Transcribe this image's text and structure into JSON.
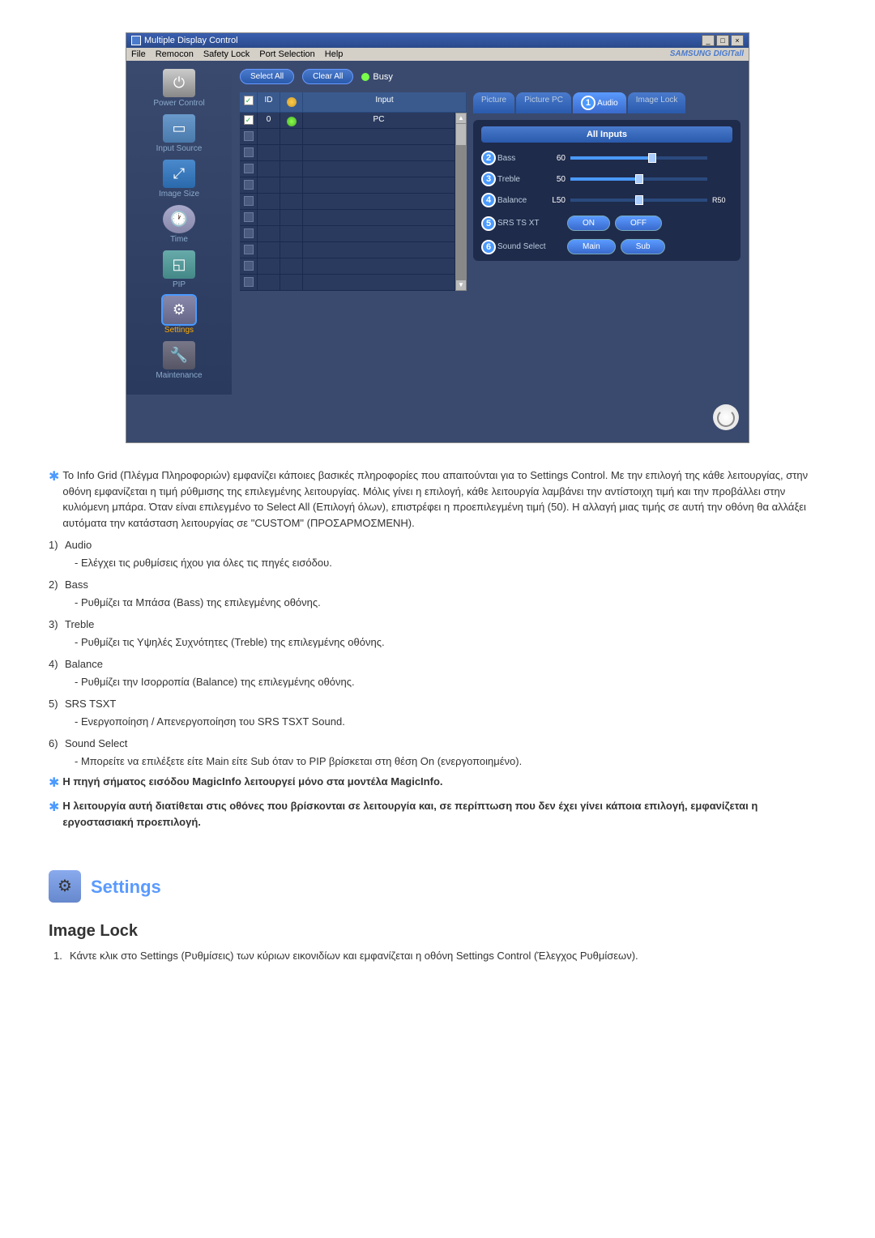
{
  "window": {
    "title": "Multiple Display Control",
    "menu": [
      "File",
      "Remocon",
      "Safety Lock",
      "Port Selection",
      "Help"
    ],
    "brand": "SAMSUNG DIGITall"
  },
  "sidebar": {
    "items": [
      {
        "label": "Power Control"
      },
      {
        "label": "Input Source"
      },
      {
        "label": "Image Size"
      },
      {
        "label": "Time"
      },
      {
        "label": "PIP"
      },
      {
        "label": "Settings"
      },
      {
        "label": "Maintenance"
      }
    ]
  },
  "toolbar": {
    "select_all": "Select All",
    "clear_all": "Clear All",
    "busy": "Busy"
  },
  "grid": {
    "headers": [
      "",
      "ID",
      "",
      "Input"
    ],
    "rows": [
      {
        "checked": true,
        "id": "0",
        "led": "green",
        "input": "PC"
      },
      {
        "checked": false,
        "id": "",
        "led": "",
        "input": ""
      },
      {
        "checked": false
      },
      {
        "checked": false
      },
      {
        "checked": false
      },
      {
        "checked": false
      },
      {
        "checked": false
      },
      {
        "checked": false
      },
      {
        "checked": false
      },
      {
        "checked": false
      },
      {
        "checked": false
      }
    ]
  },
  "tabs": {
    "picture": "Picture",
    "picture_pc": "Picture PC",
    "audio": "Audio",
    "audio_badge": "1",
    "image_lock": "Image Lock"
  },
  "panel": {
    "title": "All Inputs",
    "bass": {
      "badge": "2",
      "label": "Bass",
      "value": "60",
      "pct": 60
    },
    "treble": {
      "badge": "3",
      "label": "Treble",
      "value": "50",
      "pct": 50
    },
    "balance": {
      "badge": "4",
      "label": "Balance",
      "value": "L50",
      "right": "R50",
      "pct": 50
    },
    "srs": {
      "badge": "5",
      "label": "SRS TS XT",
      "on": "ON",
      "off": "OFF"
    },
    "sound_select": {
      "badge": "6",
      "label": "Sound Select",
      "main": "Main",
      "sub": "Sub"
    }
  },
  "doc": {
    "intro": "Το Info Grid (Πλέγμα Πληροφοριών) εμφανίζει κάποιες βασικές πληροφορίες που απαιτούνται για το Settings Control. Με την επιλογή της κάθε λειτουργίας, στην οθόνη εμφανίζεται η τιμή ρύθμισης της επιλεγμένης λειτουργίας. Μόλις γίνει η επιλογή, κάθε λειτουργία λαμβάνει την αντίστοιχη τιμή και την προβάλλει στην κυλιόμενη μπάρα. Όταν είναι επιλεγμένο το Select All (Επιλογή όλων), επιστρέφει η προεπιλεγμένη τιμή (50). Η αλλαγή μιας τιμής σε αυτή την οθόνη θα αλλάξει αυτόματα την κατάσταση λειτουργίας σε \"CUSTOM\" (ΠΡΟΣΑΡΜΟΣΜΕΝΗ).",
    "items": [
      {
        "n": "1)",
        "title": "Audio",
        "desc": "- Ελέγχει τις ρυθμίσεις ήχου για όλες τις πηγές εισόδου."
      },
      {
        "n": "2)",
        "title": "Bass",
        "desc": "- Ρυθμίζει τα Μπάσα (Bass) της επιλεγμένης οθόνης."
      },
      {
        "n": "3)",
        "title": "Treble",
        "desc": "- Ρυθμίζει τις Υψηλές Συχνότητες (Treble) της επιλεγμένης οθόνης."
      },
      {
        "n": "4)",
        "title": "Balance",
        "desc": "- Ρυθμίζει την Ισορροπία (Balance) της επιλεγμένης οθόνης."
      },
      {
        "n": "5)",
        "title": "SRS TSXT",
        "desc": "- Ενεργοποίηση / Απενεργοποίηση του SRS TSXT Sound."
      },
      {
        "n": "6)",
        "title": "Sound Select",
        "desc": "- Μπορείτε να επιλέξετε είτε Main είτε Sub όταν το PIP βρίσκεται στη θέση On (ενεργοποιημένο)."
      }
    ],
    "note1": "Η πηγή σήματος εισόδου MagicInfo λειτουργεί μόνο στα μοντέλα MagicInfo.",
    "note2": "Η λειτουργία αυτή διατίθεται στις οθόνες που βρίσκονται σε λειτουργία και, σε περίπτωση που δεν έχει γίνει κάποια επιλογή, εμφανίζεται η εργοστασιακή προεπιλογή."
  },
  "section": {
    "title": "Settings",
    "subtitle": "Image Lock",
    "step1_n": "1.",
    "step1": "Κάντε κλικ στο Settings (Ρυθμίσεις) των κύριων εικονιδίων και εμφανίζεται η οθόνη Settings Control (Έλεγχος Ρυθμίσεων)."
  }
}
